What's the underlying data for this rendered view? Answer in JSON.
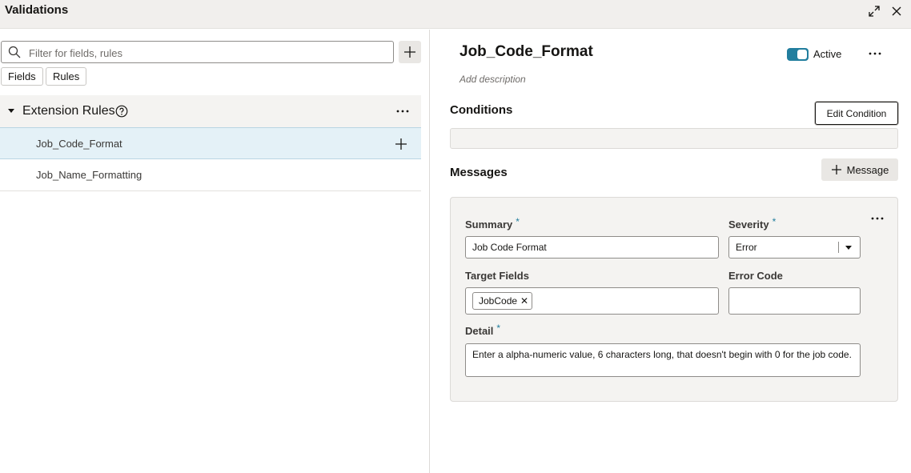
{
  "window": {
    "title": "Validations",
    "expand_icon": "expand-icon",
    "close_icon": "close-icon"
  },
  "left": {
    "search": {
      "placeholder": "Filter for fields, rules",
      "value": ""
    },
    "filters": [
      "Fields",
      "Rules"
    ],
    "section": {
      "title": "Extension Rules"
    },
    "rules": [
      {
        "label": "Job_Code_Format",
        "selected": true
      },
      {
        "label": "Job_Name_Formatting",
        "selected": false
      }
    ]
  },
  "detail": {
    "title": "Job_Code_Format",
    "status_label": "Active",
    "status_on": true,
    "description_placeholder": "Add description",
    "conditions": {
      "heading": "Conditions",
      "edit_label": "Edit Condition"
    },
    "messages": {
      "heading": "Messages",
      "add_label": "Message",
      "items": [
        {
          "summary_label": "Summary",
          "summary_value": "Job Code Format",
          "severity_label": "Severity",
          "severity_value": "Error",
          "target_label": "Target Fields",
          "target_tokens": [
            "JobCode"
          ],
          "error_code_label": "Error Code",
          "error_code_value": "",
          "detail_label": "Detail",
          "detail_value": "Enter a alpha-numeric value, 6 characters long, that doesn't begin with 0 for the job code.",
          "required_mark": "*"
        }
      ]
    }
  },
  "colors": {
    "accent": "#227e9e",
    "selected_row": "#e4f1f7",
    "panel_bg": "#f4f3f1"
  }
}
